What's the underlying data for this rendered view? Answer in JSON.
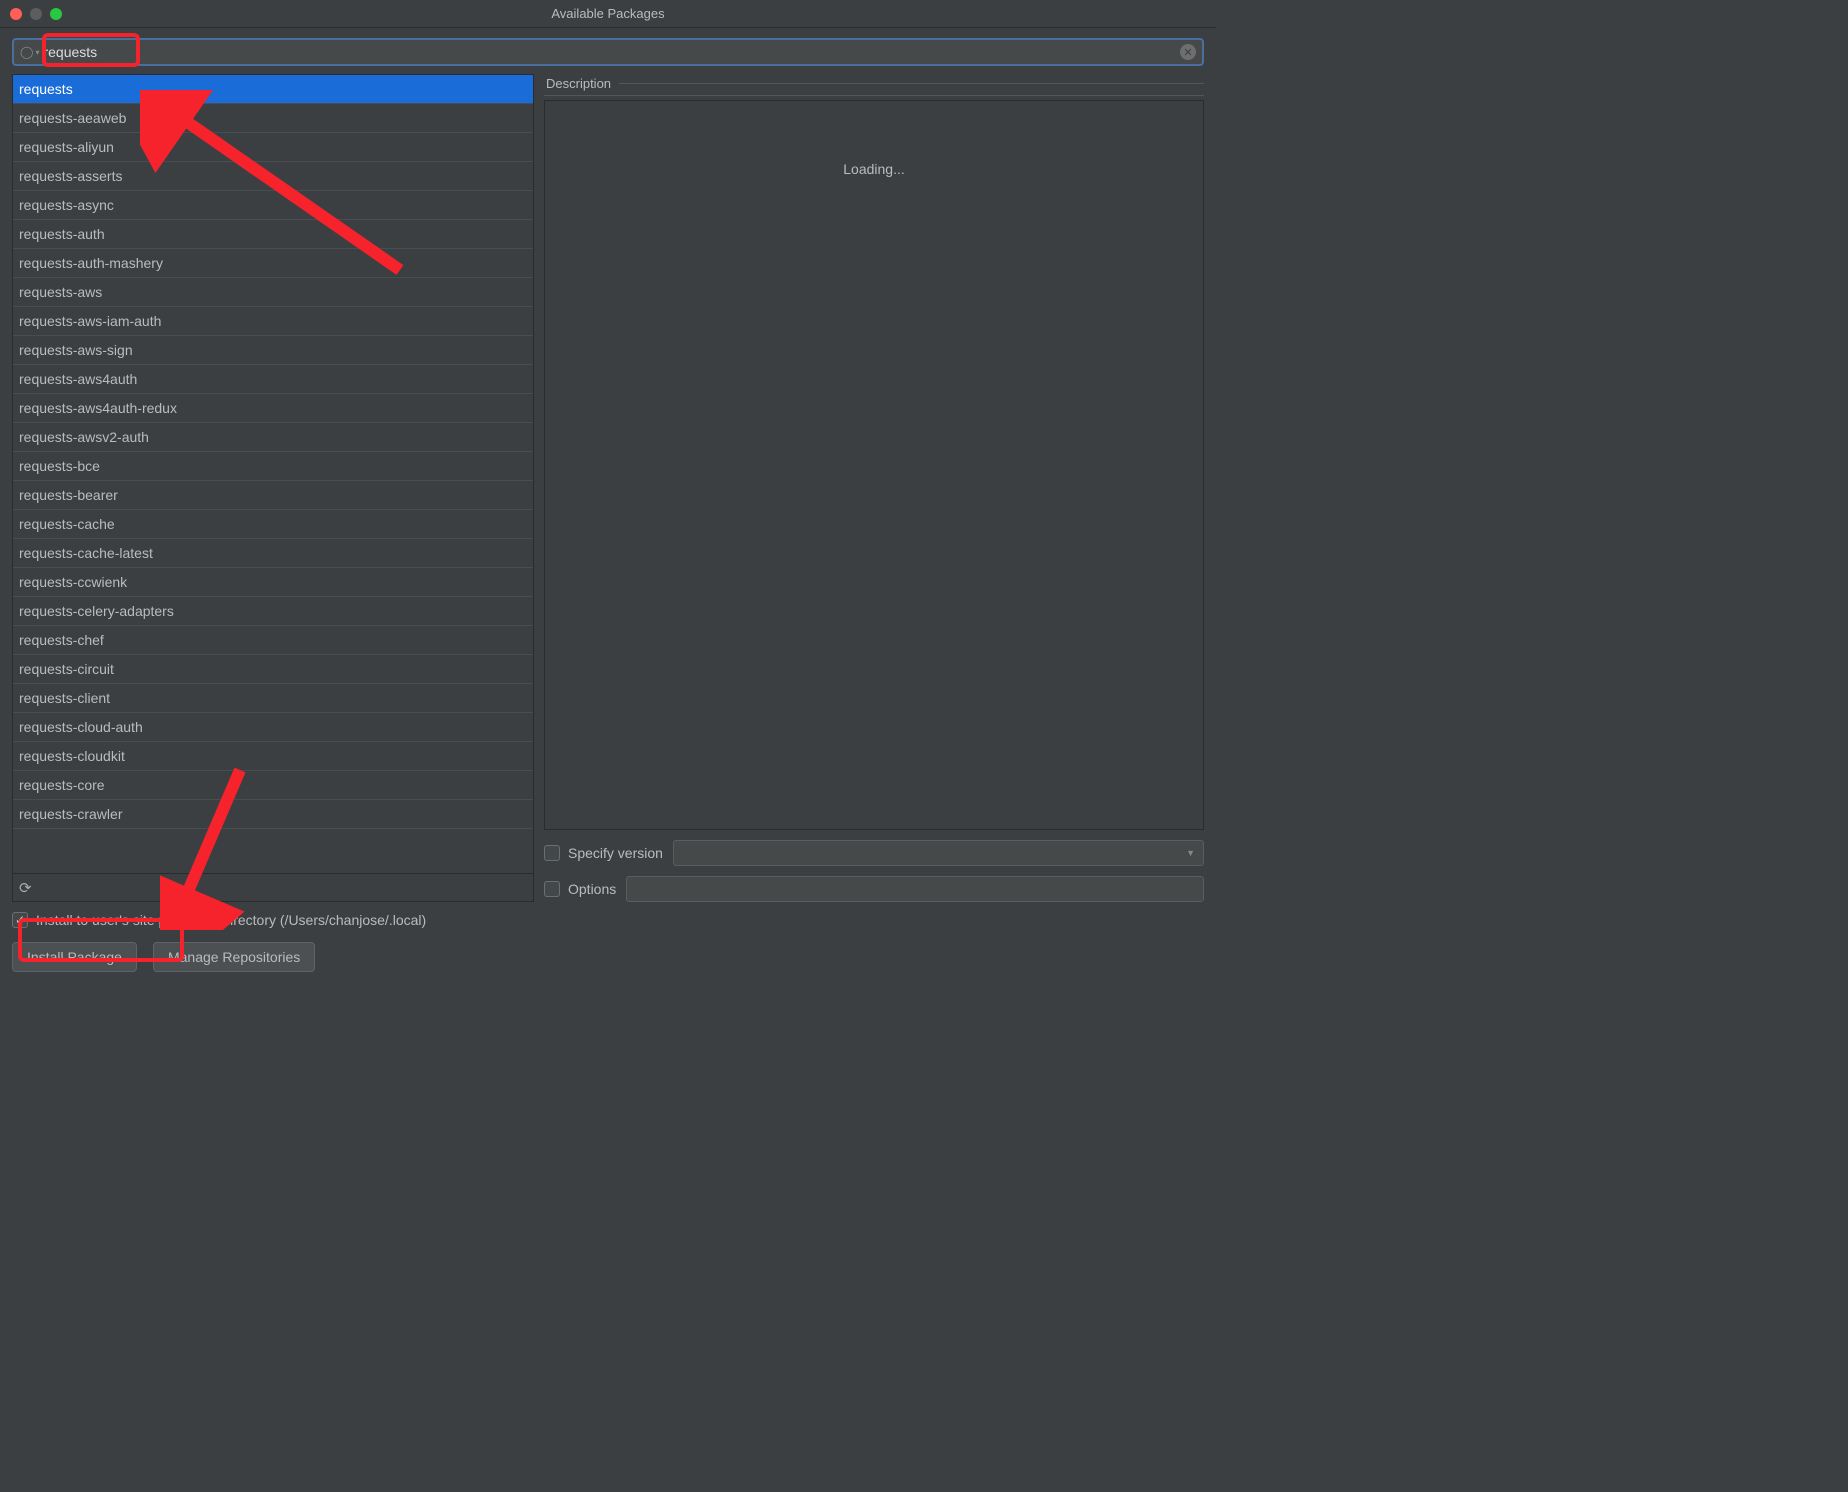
{
  "window": {
    "title": "Available Packages"
  },
  "search": {
    "value": "requests"
  },
  "packages": [
    "requests",
    "requests-aeaweb",
    "requests-aliyun",
    "requests-asserts",
    "requests-async",
    "requests-auth",
    "requests-auth-mashery",
    "requests-aws",
    "requests-aws-iam-auth",
    "requests-aws-sign",
    "requests-aws4auth",
    "requests-aws4auth-redux",
    "requests-awsv2-auth",
    "requests-bce",
    "requests-bearer",
    "requests-cache",
    "requests-cache-latest",
    "requests-ccwienk",
    "requests-celery-adapters",
    "requests-chef",
    "requests-circuit",
    "requests-client",
    "requests-cloud-auth",
    "requests-cloudkit",
    "requests-core",
    "requests-crawler"
  ],
  "selected_index": 0,
  "description": {
    "header": "Description",
    "loading": "Loading..."
  },
  "options": {
    "specify_version_label": "Specify version",
    "specify_version_checked": false,
    "options_label": "Options",
    "options_checked": false
  },
  "footer": {
    "install_user_label": "Install to user's site packages directory (/Users/chanjose/.local)",
    "install_user_checked": true,
    "install_btn": "Install Package",
    "manage_btn": "Manage Repositories"
  },
  "colors": {
    "selection": "#1a6dd8",
    "annotation": "#f6232d"
  }
}
